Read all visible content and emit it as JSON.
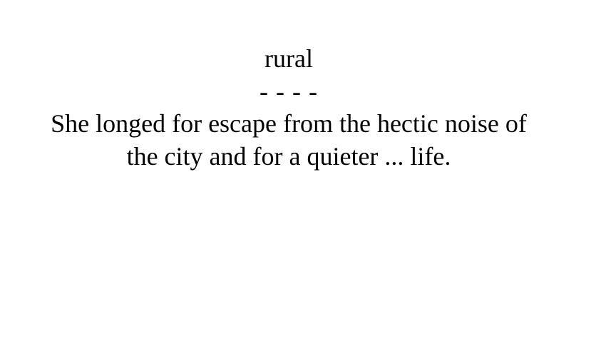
{
  "card": {
    "word": "rural",
    "blanks": "- - - -",
    "sentence_line_1": "She longed for escape from the hectic noise of",
    "sentence_line_2": "the city and for a quieter ... life."
  }
}
